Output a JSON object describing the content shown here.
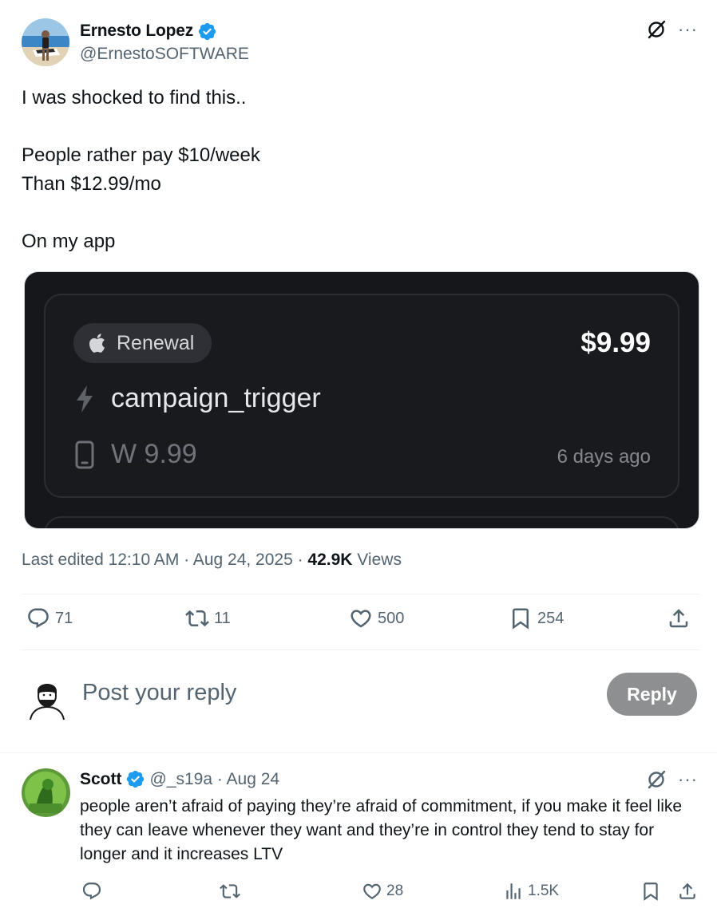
{
  "post": {
    "author_name": "Ernesto Lopez",
    "author_handle": "@ErnestoSOFTWARE",
    "text_lines": [
      "I was shocked to find this..",
      "",
      "People rather pay $10/week",
      "Than $12.99/mo",
      "",
      "On my app"
    ],
    "media": {
      "pill_label": "Renewal",
      "price": "$9.99",
      "trigger": "campaign_trigger",
      "product": "W 9.99",
      "time_ago": "6 days ago"
    },
    "meta": {
      "edited": "Last edited 12:10 AM · Aug 24, 2025 · ",
      "views_count": "42.9K",
      "views_label": " Views"
    },
    "stats": {
      "replies": "71",
      "reposts": "11",
      "likes": "500",
      "bookmarks": "254"
    }
  },
  "reply_box": {
    "placeholder": "Post your reply",
    "button_label": "Reply"
  },
  "reply": {
    "author_name": "Scott",
    "handle_date": "@_s19a · Aug 24",
    "text": "people aren’t afraid of paying they’re afraid of commitment, if you make it feel like they can leave whenever they want and they’re in control they tend to stay for longer and it increases LTV",
    "stats": {
      "likes": "28",
      "views": "1.5K"
    }
  },
  "colors": {
    "verified": "#1d9bf0",
    "muted": "#536471",
    "reply_button": "#8e8f91",
    "media_bg": "#16171b"
  },
  "icons": [
    "verified-badge-icon",
    "grok-icon",
    "more-icon",
    "apple-icon",
    "bolt-icon",
    "phone-icon",
    "reply-icon",
    "repost-icon",
    "like-icon",
    "bookmark-icon",
    "share-icon",
    "views-icon"
  ]
}
